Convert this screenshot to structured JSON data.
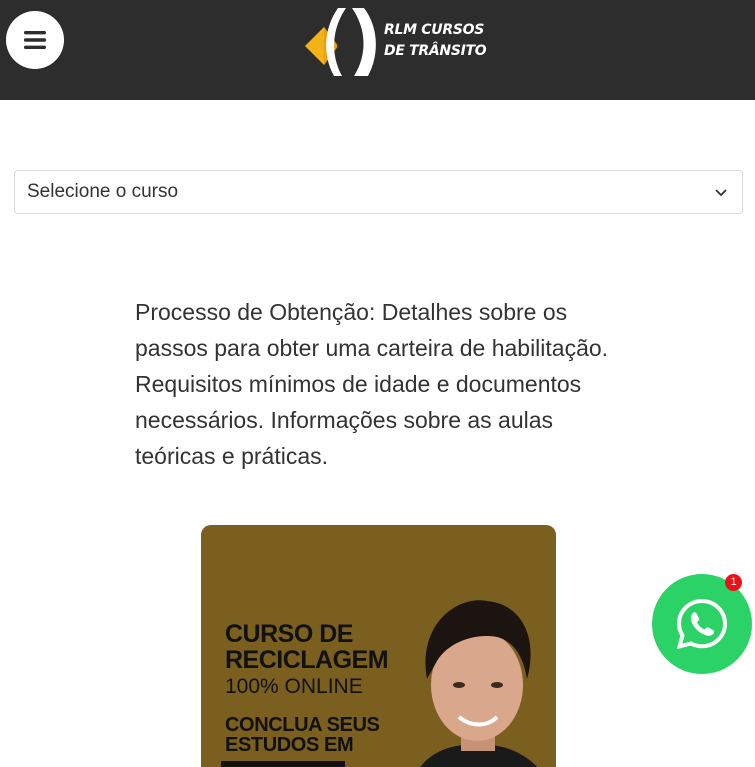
{
  "header": {
    "logo_line1": "RLM CURSOS",
    "logo_line2": "DE TRÂNSITO",
    "menu_icon": "hamburger-icon"
  },
  "course_select": {
    "selected": "Selecione o curso",
    "icon": "chevron-down-icon"
  },
  "description": "Processo de Obtenção: Detalhes sobre os passos para obter uma carteira de habilitação. Requisitos mínimos de idade e documentos necessários. Informações sobre as aulas teóricas e práticas.",
  "banner": {
    "title_line1": "CURSO DE",
    "title_line2": "RECICLAGEM",
    "subtitle": "100% ONLINE",
    "cta_line1": "CONCLUA SEUS",
    "cta_line2": "ESTUDOS EM",
    "background_color": "#7a5f1f"
  },
  "whatsapp": {
    "icon": "whatsapp-icon",
    "badge_count": "1",
    "color": "#2bd366"
  }
}
